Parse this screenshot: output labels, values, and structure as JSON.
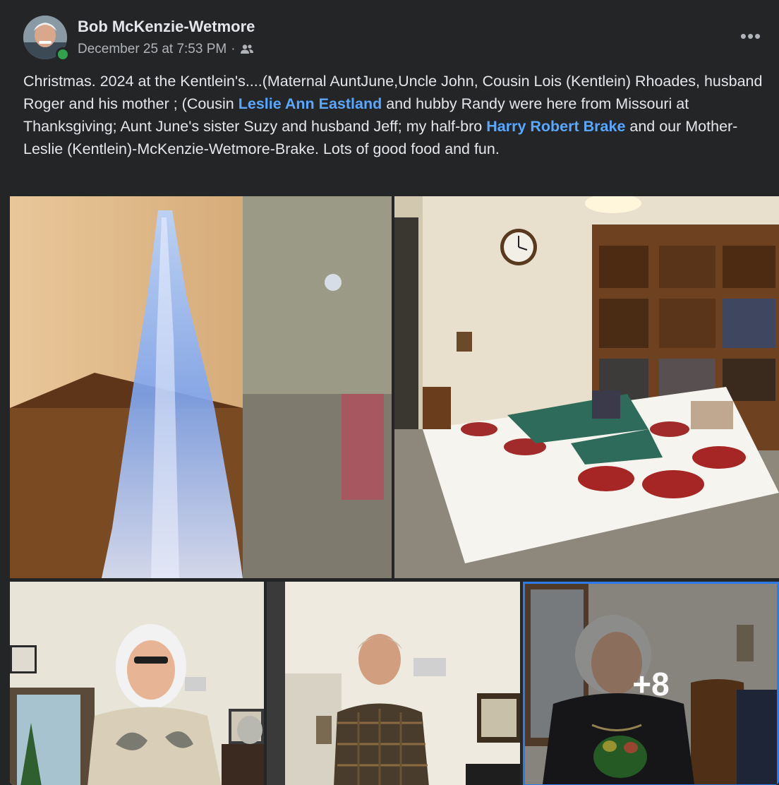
{
  "post": {
    "author": "Bob McKenzie-Wetmore",
    "timestamp": "December 25 at 7:53 PM",
    "separator": "·",
    "audience_icon": "friends-icon",
    "more_icon": "more-horizontal-icon",
    "more_label": "•••",
    "text_segments": [
      "Christmas. 2024 at the Kentlein's....(Maternal AuntJune,Uncle John, Cousin Lois (Kentlein) Rhoades, husband Roger and his mother ; (Cousin ",
      " and hubby Randy were here from Missouri at Thanksgiving; Aunt June's sister Suzy and husband Jeff; my half-bro ",
      " and our Mother-Leslie (Kentlein)-McKenzie-Wetmore-Brake. Lots of good food and fun."
    ],
    "mentions": [
      "Leslie Ann Eastland",
      "Harry Robert Brake"
    ],
    "more_photos_label": "+8"
  },
  "colors": {
    "background": "#242526",
    "text": "#e4e6eb",
    "secondary_text": "#b0b3b8",
    "link": "#5aa7ff",
    "online": "#31a24c",
    "selected_border": "#2d7be8"
  }
}
